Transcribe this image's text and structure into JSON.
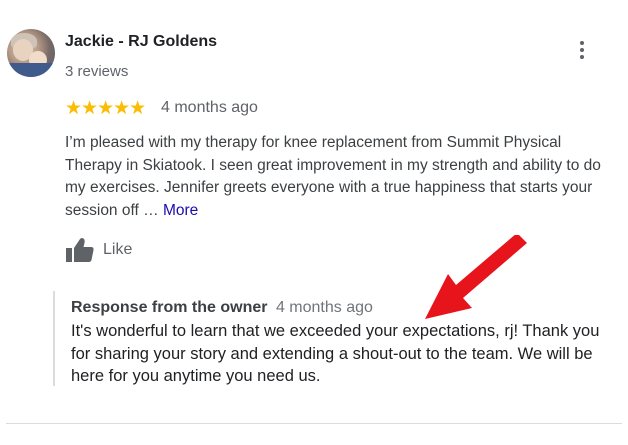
{
  "reviewer": {
    "name": "Jackie - RJ Goldens",
    "reviews_count": "3 reviews"
  },
  "rating": {
    "stars": "★★★★★",
    "value": 5,
    "time": "4 months ago"
  },
  "review": {
    "text": "I’m pleased with my therapy for knee replacement from Summit  Physical Therapy in Skiatook. I seen great improvement in my strength and ability to do  my exercises. Jennifer greets everyone with a true happiness that starts your session off … ",
    "more_label": "More"
  },
  "actions": {
    "like_label": "Like"
  },
  "owner_response": {
    "title": "Response from the owner",
    "time": "4 months ago",
    "text": "It's wonderful to learn that we exceeded your expectations, rj! Thank you for sharing your story and extending a shout-out to the team. We will be here for you anytime you need us."
  },
  "icons": {
    "menu": "more-vert-icon",
    "like": "thumbs-up-icon",
    "annotation": "red-arrow-icon"
  },
  "colors": {
    "star": "#fbbc04",
    "link": "#1a0dab",
    "arrow": "#e8141c"
  }
}
